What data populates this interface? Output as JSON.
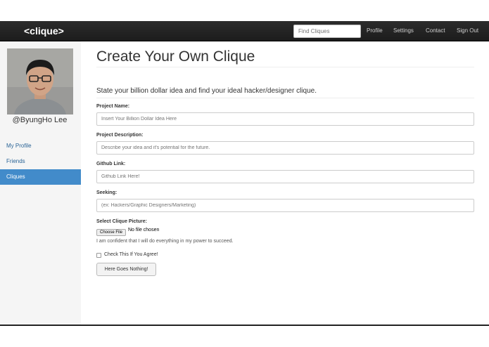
{
  "navbar": {
    "brand": "<clique>",
    "search_placeholder": "Find Cliques",
    "links": [
      "Profile",
      "Settings",
      "Contact",
      "Sign Out"
    ]
  },
  "sidebar": {
    "username": "@ByungHo Lee",
    "items": [
      {
        "label": "My Profile",
        "active": false
      },
      {
        "label": "Friends",
        "active": false
      },
      {
        "label": "Cliques",
        "active": true
      }
    ]
  },
  "form": {
    "title": "Create Your Own Clique",
    "subtitle": "State your billion dollar idea and find your ideal hacker/designer clique.",
    "project_name": {
      "label": "Project Name:",
      "placeholder": "Insert Your Billion Dollar Idea Here"
    },
    "project_description": {
      "label": "Project Description:",
      "placeholder": "Describe your idea and it's potential for the future."
    },
    "github_link": {
      "label": "Github Link:",
      "placeholder": "Github Link Here!"
    },
    "seeking": {
      "label": "Seeking:",
      "placeholder": "(ex: Hackers/Graphic Designers/Marketing)"
    },
    "picture": {
      "label": "Select Clique Picture:",
      "button": "Choose File",
      "status": "No file chosen"
    },
    "help_text": "I am confident that I will do everything in my power to succeed.",
    "checkbox_label": "Check This If You Agree!",
    "submit_label": "Here Goes Nothing!"
  }
}
